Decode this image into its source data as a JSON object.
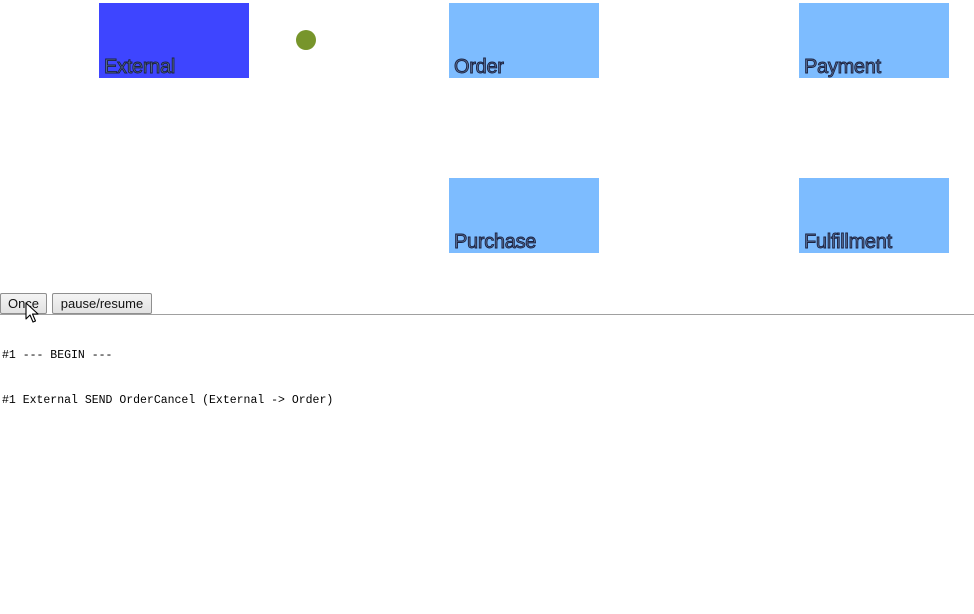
{
  "colors": {
    "active_node": "#3e45ff",
    "inactive_node": "#7dbcff",
    "message_dot": "#77952b"
  },
  "nodes": {
    "external": {
      "label": "External",
      "state": "active"
    },
    "order": {
      "label": "Order",
      "state": "inactive"
    },
    "payment": {
      "label": "Payment",
      "state": "inactive"
    },
    "purchase": {
      "label": "Purchase",
      "state": "inactive"
    },
    "fulfillment": {
      "label": "Fulfillment",
      "state": "inactive"
    }
  },
  "controls": {
    "once_label": "Once",
    "pause_label": "pause/resume"
  },
  "log": {
    "lines": [
      "#1 --- BEGIN ---",
      "#1 External SEND OrderCancel (External -> Order)"
    ]
  },
  "cursor": {
    "icon": "arrow-pointer-icon"
  }
}
